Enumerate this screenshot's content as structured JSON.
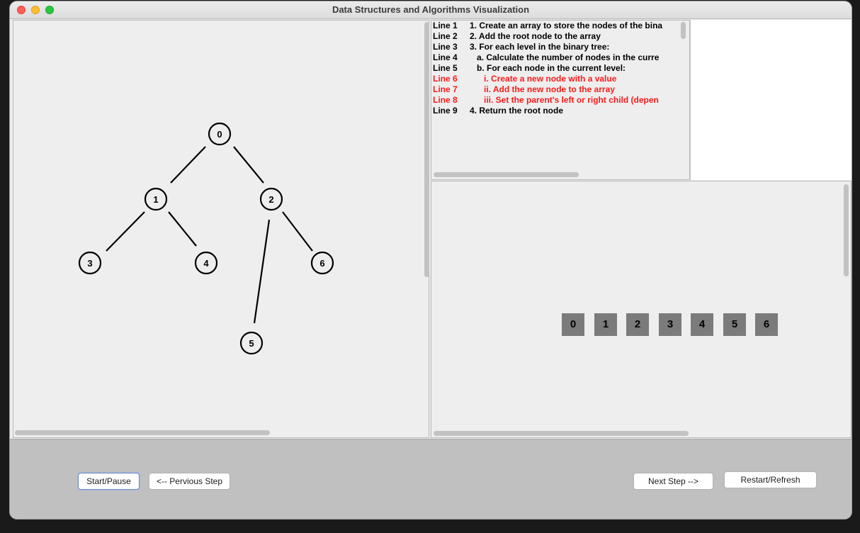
{
  "window": {
    "title": "Data Structures and Algorithms Visualization"
  },
  "tree": {
    "nodes": [
      {
        "label": "0"
      },
      {
        "label": "1"
      },
      {
        "label": "2"
      },
      {
        "label": "3"
      },
      {
        "label": "4"
      },
      {
        "label": "5"
      },
      {
        "label": "6"
      }
    ]
  },
  "code": {
    "lines": [
      {
        "num": "Line 1",
        "text": "1. Create an array to store the nodes of the bina",
        "highlighted": false
      },
      {
        "num": "Line 2",
        "text": "2. Add the root node to the array",
        "highlighted": false
      },
      {
        "num": "Line 3",
        "text": "3. For each level in the binary tree:",
        "highlighted": false
      },
      {
        "num": "Line 4",
        "text": "   a. Calculate the number of nodes in the curre",
        "highlighted": false
      },
      {
        "num": "Line 5",
        "text": "   b. For each node in the current level:",
        "highlighted": false
      },
      {
        "num": "Line 6",
        "text": "      i. Create a new node with a value",
        "highlighted": true
      },
      {
        "num": "Line 7",
        "text": "      ii. Add the new node to the array",
        "highlighted": true
      },
      {
        "num": "Line 8",
        "text": "      iii. Set the parent's left or right child (depen",
        "highlighted": true
      },
      {
        "num": "Line 9",
        "text": "4. Return the root node",
        "highlighted": false
      }
    ],
    "highlight_color": "#ff1a1a"
  },
  "array": {
    "cells": [
      "0",
      "1",
      "2",
      "3",
      "4",
      "5",
      "6"
    ]
  },
  "controls": {
    "start_pause": "Start/Pause",
    "previous": "<-- Pervious Step",
    "next": "Next Step -->",
    "restart": "Restart/Refresh"
  }
}
